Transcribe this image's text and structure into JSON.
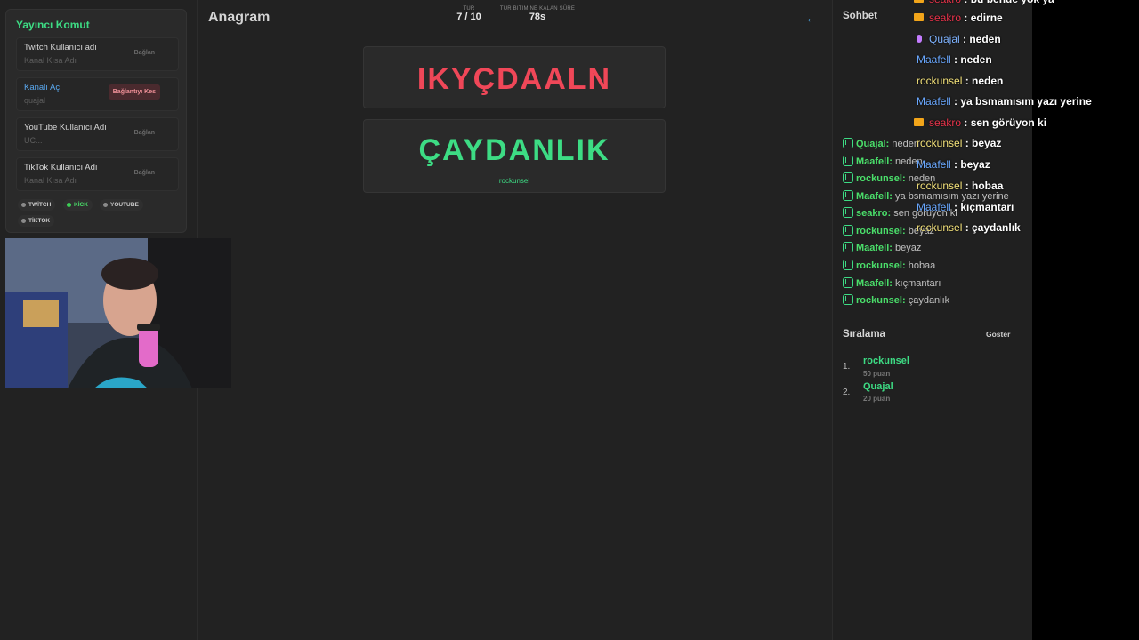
{
  "left_panel": {
    "title": "Yayıncı Komut",
    "accounts": [
      {
        "name": "Twitch Kullanıcı adı",
        "sub": "Kanal Kısa Adı",
        "button": "Bağlan"
      },
      {
        "name": "Kanalı Aç",
        "sub": "quajal",
        "button": "Bağlantıyı Kes"
      },
      {
        "name": "YouTube Kullanıcı Adı",
        "sub": "UC...",
        "button": "Bağlan"
      },
      {
        "name": "TikTok Kullanıcı Adı",
        "sub": "Kanal Kısa Adı",
        "button": "Bağlan"
      }
    ],
    "platforms": [
      "TWİTCH",
      "KİCK",
      "YOUTUBE",
      "TİKTOK"
    ]
  },
  "header": {
    "title": "Anagram",
    "round_label": "TUR",
    "round_value": "7 / 10",
    "time_label": "TUR BITIMINE KALAN SÜRE",
    "time_value": "78s"
  },
  "game": {
    "scrambled": "IKYÇDAALN",
    "answer": "ÇAYDANLIK",
    "winner": "rockunsel"
  },
  "chat": {
    "title": "Sohbet",
    "messages": [
      {
        "user": "Quajal:",
        "text": "neden"
      },
      {
        "user": "Maafell:",
        "text": "neden"
      },
      {
        "user": "rockunsel:",
        "text": "neden"
      },
      {
        "user": "Maafell:",
        "text": "ya bsmamısım yazı yerine"
      },
      {
        "user": "seakro:",
        "text": "sen görüyon ki"
      },
      {
        "user": "rockunsel:",
        "text": "beyaz"
      },
      {
        "user": "Maafell:",
        "text": "beyaz"
      },
      {
        "user": "rockunsel:",
        "text": "hobaa"
      },
      {
        "user": "Maafell:",
        "text": "kıçmantarı"
      },
      {
        "user": "rockunsel:",
        "text": "çaydanlık"
      }
    ]
  },
  "ranking": {
    "title": "Sıralama",
    "show_label": "Göster",
    "entries": [
      {
        "rank": "1.",
        "name": "rockunsel",
        "points": "50 puan"
      },
      {
        "rank": "2.",
        "name": "Quajal",
        "points": "20 puan"
      }
    ]
  },
  "overlay_chat": [
    {
      "user": "seakro",
      "text": " : bu bende yok ya",
      "color": "#e8324a",
      "badge": "crown"
    },
    {
      "user": "seakro",
      "text": " : edirne",
      "color": "#e8324a",
      "badge": "crown"
    },
    {
      "user": "Quajal",
      "text": " : neden",
      "color": "#7fb3ff",
      "badge": "mic"
    },
    {
      "user": "Maafell",
      "text": " : neden",
      "color": "#6aa8ff",
      "badge": ""
    },
    {
      "user": "rockunsel",
      "text": " : neden",
      "color": "#f4e27a",
      "badge": ""
    },
    {
      "user": "Maafell",
      "text": " : ya bsmamısım yazı yerine",
      "color": "#6aa8ff",
      "badge": ""
    },
    {
      "user": "seakro",
      "text": " : sen görüyon ki",
      "color": "#e8324a",
      "badge": "crown"
    },
    {
      "user": "rockunsel",
      "text": " : beyaz",
      "color": "#f4e27a",
      "badge": ""
    },
    {
      "user": "Maafell",
      "text": " : beyaz",
      "color": "#6aa8ff",
      "badge": ""
    },
    {
      "user": "rockunsel",
      "text": " : hobaa",
      "color": "#f4e27a",
      "badge": ""
    },
    {
      "user": "Maafell",
      "text": " : kıçmantarı",
      "color": "#6aa8ff",
      "badge": ""
    },
    {
      "user": "rockunsel",
      "text": " : çaydanlık",
      "color": "#f4e27a",
      "badge": ""
    }
  ],
  "colors": {
    "accent": "#3ddc84",
    "scrambled": "#f04758",
    "background": "#222222"
  }
}
